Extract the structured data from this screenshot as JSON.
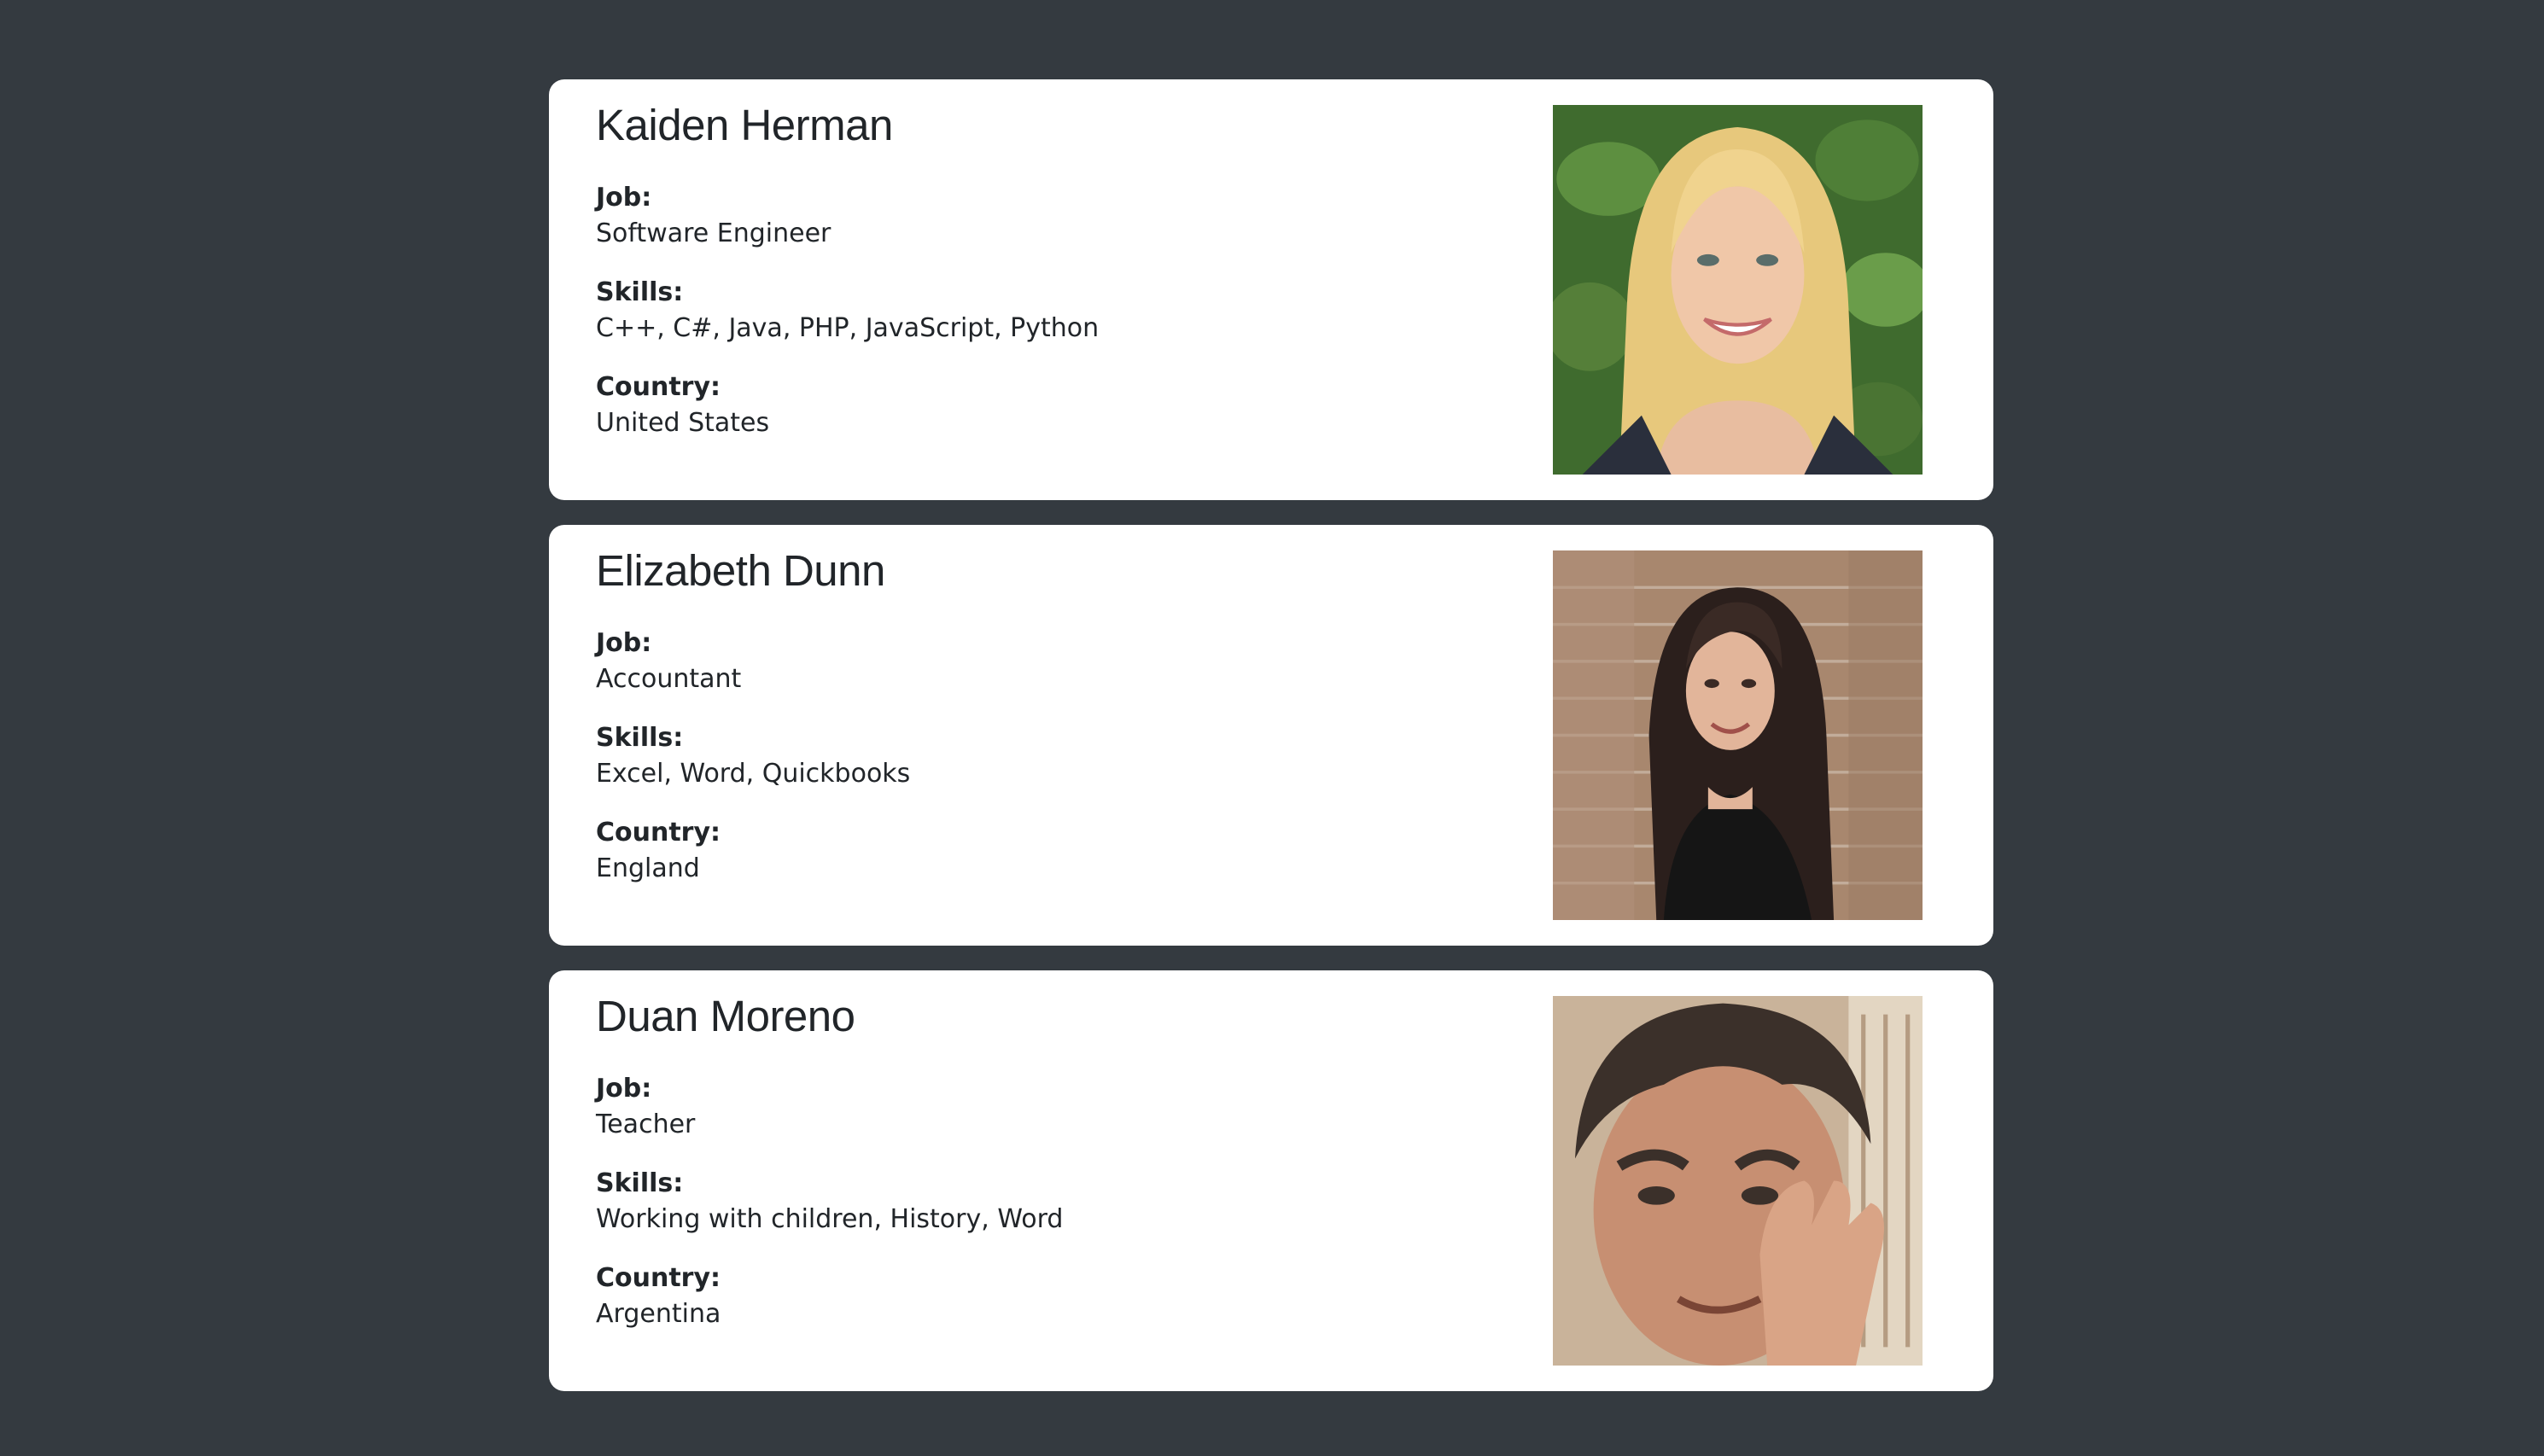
{
  "labels": {
    "job": "Job:",
    "skills": "Skills:",
    "country": "Country:"
  },
  "people": [
    {
      "name": "Kaiden Herman",
      "job": "Software Engineer",
      "skills": "C++, C#, Java, PHP, JavaScript, Python",
      "country": "United States",
      "photo": "portrait-blonde-woman-smiling"
    },
    {
      "name": "Elizabeth Dunn",
      "job": "Accountant",
      "skills": "Excel, Word, Quickbooks",
      "country": "England",
      "photo": "portrait-dark-haired-woman-brick-wall"
    },
    {
      "name": "Duan Moreno",
      "job": "Teacher",
      "skills": "Working with children, History, Word",
      "country": "Argentina",
      "photo": "portrait-man-waving-close-up"
    }
  ]
}
